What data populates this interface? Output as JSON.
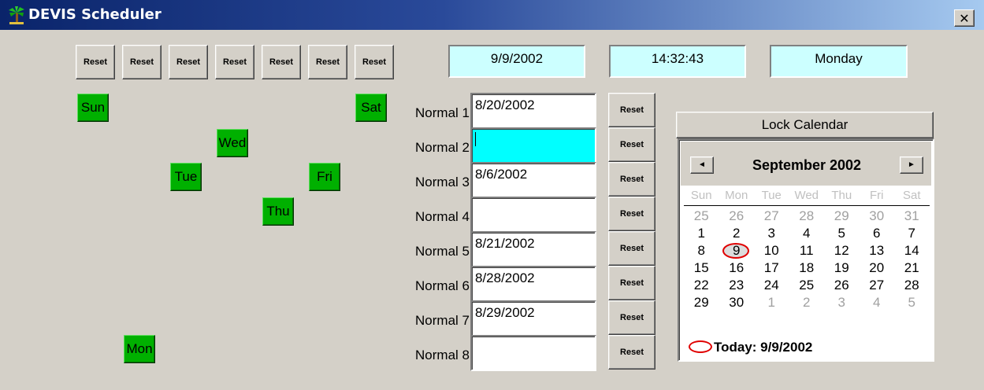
{
  "window": {
    "title": "DEVIS Scheduler",
    "close_label": "✕"
  },
  "reset_buttons_top": [
    "Reset",
    "Reset",
    "Reset",
    "Reset",
    "Reset",
    "Reset",
    "Reset"
  ],
  "info": {
    "date": "9/9/2002",
    "time": "14:32:43",
    "weekday": "Monday"
  },
  "days": {
    "sun": "Sun",
    "mon": "Mon",
    "tue": "Tue",
    "wed": "Wed",
    "thu": "Thu",
    "fri": "Fri",
    "sat": "Sat"
  },
  "normals": [
    {
      "label": "Normal 1",
      "value": "8/20/2002",
      "reset": "Reset"
    },
    {
      "label": "Normal 2",
      "value": "",
      "reset": "Reset"
    },
    {
      "label": "Normal 3",
      "value": "8/6/2002",
      "reset": "Reset"
    },
    {
      "label": "Normal 4",
      "value": "",
      "reset": "Reset"
    },
    {
      "label": "Normal 5",
      "value": "8/21/2002",
      "reset": "Reset"
    },
    {
      "label": "Normal 6",
      "value": "8/28/2002",
      "reset": "Reset"
    },
    {
      "label": "Normal 7",
      "value": "8/29/2002",
      "reset": "Reset"
    },
    {
      "label": "Normal 8",
      "value": "",
      "reset": "Reset"
    }
  ],
  "lock_calendar_label": "Lock Calendar",
  "calendar": {
    "month_label": "September 2002",
    "prev_arrow": "◄",
    "next_arrow": "►",
    "weekdays": [
      "Sun",
      "Mon",
      "Tue",
      "Wed",
      "Thu",
      "Fri",
      "Sat"
    ],
    "weeks": [
      [
        "25",
        "26",
        "27",
        "28",
        "29",
        "30",
        "31"
      ],
      [
        "1",
        "2",
        "3",
        "4",
        "5",
        "6",
        "7"
      ],
      [
        "8",
        "9",
        "10",
        "11",
        "12",
        "13",
        "14"
      ],
      [
        "15",
        "16",
        "17",
        "18",
        "19",
        "20",
        "21"
      ],
      [
        "22",
        "23",
        "24",
        "25",
        "26",
        "27",
        "28"
      ],
      [
        "29",
        "30",
        "1",
        "2",
        "3",
        "4",
        "5"
      ]
    ],
    "selected": "9",
    "today_label": "Today: 9/9/2002"
  },
  "colors": {
    "info_bg": "#ccffff",
    "day_button": "#00b000",
    "active_field": "#00ffff",
    "titlebar": "#0a246a",
    "today_circle": "#e00000"
  }
}
